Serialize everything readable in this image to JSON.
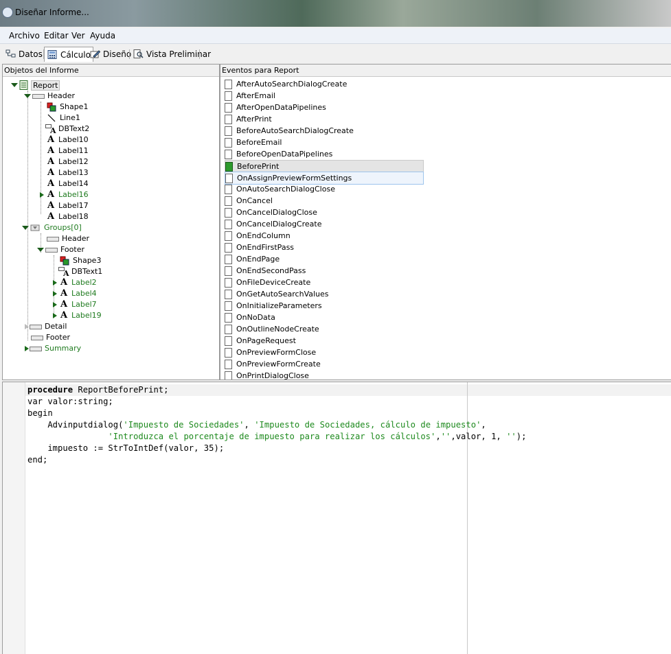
{
  "window": {
    "title": "Diseñar Informe..."
  },
  "menu": [
    "Archivo",
    "Editar",
    "Ver",
    "Ayuda"
  ],
  "tabs": [
    "Datos",
    "Cálculo",
    "Diseño",
    "Vista Preliminar"
  ],
  "objects_panel": {
    "title": "Objetos del Informe",
    "nodes": {
      "report": "Report",
      "header": "Header",
      "shape1": "Shape1",
      "line1": "Line1",
      "dbtext2": "DBText2",
      "label10": "Label10",
      "label11": "Label11",
      "label12": "Label12",
      "label13": "Label13",
      "label14": "Label14",
      "label16": "Label16",
      "label17": "Label17",
      "label18": "Label18",
      "groups": "Groups[0]",
      "g_header": "Header",
      "g_footer": "Footer",
      "shape3": "Shape3",
      "dbtext1": "DBText1",
      "label2": "Label2",
      "label4": "Label4",
      "label7": "Label7",
      "label19": "Label19",
      "detail": "Detail",
      "footer": "Footer",
      "summary": "Summary"
    }
  },
  "events_panel": {
    "title": "Eventos para Report",
    "events": [
      "AfterAutoSearchDialogCreate",
      "AfterEmail",
      "AfterOpenDataPipelines",
      "AfterPrint",
      "BeforeAutoSearchDialogCreate",
      "BeforeEmail",
      "BeforeOpenDataPipelines",
      "BeforePrint",
      "OnAssignPreviewFormSettings",
      "OnAutoSearchDialogClose",
      "OnCancel",
      "OnCancelDialogClose",
      "OnCancelDialogCreate",
      "OnEndColumn",
      "OnEndFirstPass",
      "OnEndPage",
      "OnEndSecondPass",
      "OnFileDeviceCreate",
      "OnGetAutoSearchValues",
      "OnInitializeParameters",
      "OnNoData",
      "OnOutlineNodeCreate",
      "OnPageRequest",
      "OnPreviewFormClose",
      "OnPreviewFormCreate",
      "OnPrintDialogClose"
    ],
    "selected": "BeforePrint",
    "hovered": "OnAssignPreviewFormSettings"
  },
  "code": {
    "l1_kw": "procedure",
    "l1_rest": " ReportBeforePrint;",
    "l2_kw": "var",
    "l2_rest": " valor:string;",
    "l3_kw": "begin",
    "l4_a": "    Advinputdialog(",
    "l4_s1": "'Impuesto de Sociedades'",
    "l4_b": ", ",
    "l4_s2": "'Impuesto de Sociedades, cálculo de impuesto'",
    "l4_c": ",",
    "l5_a": "                ",
    "l5_s1": "'Introduzca el porcentaje de impuesto para realizar los cálculos'",
    "l5_b": ",",
    "l5_s2": "''",
    "l5_c": ",valor, 1, ",
    "l5_s3": "''",
    "l5_d": ");",
    "l6": "    impuesto := StrToIntDef(valor, 35);",
    "l7_kw": "end",
    "l7_rest": ";"
  }
}
